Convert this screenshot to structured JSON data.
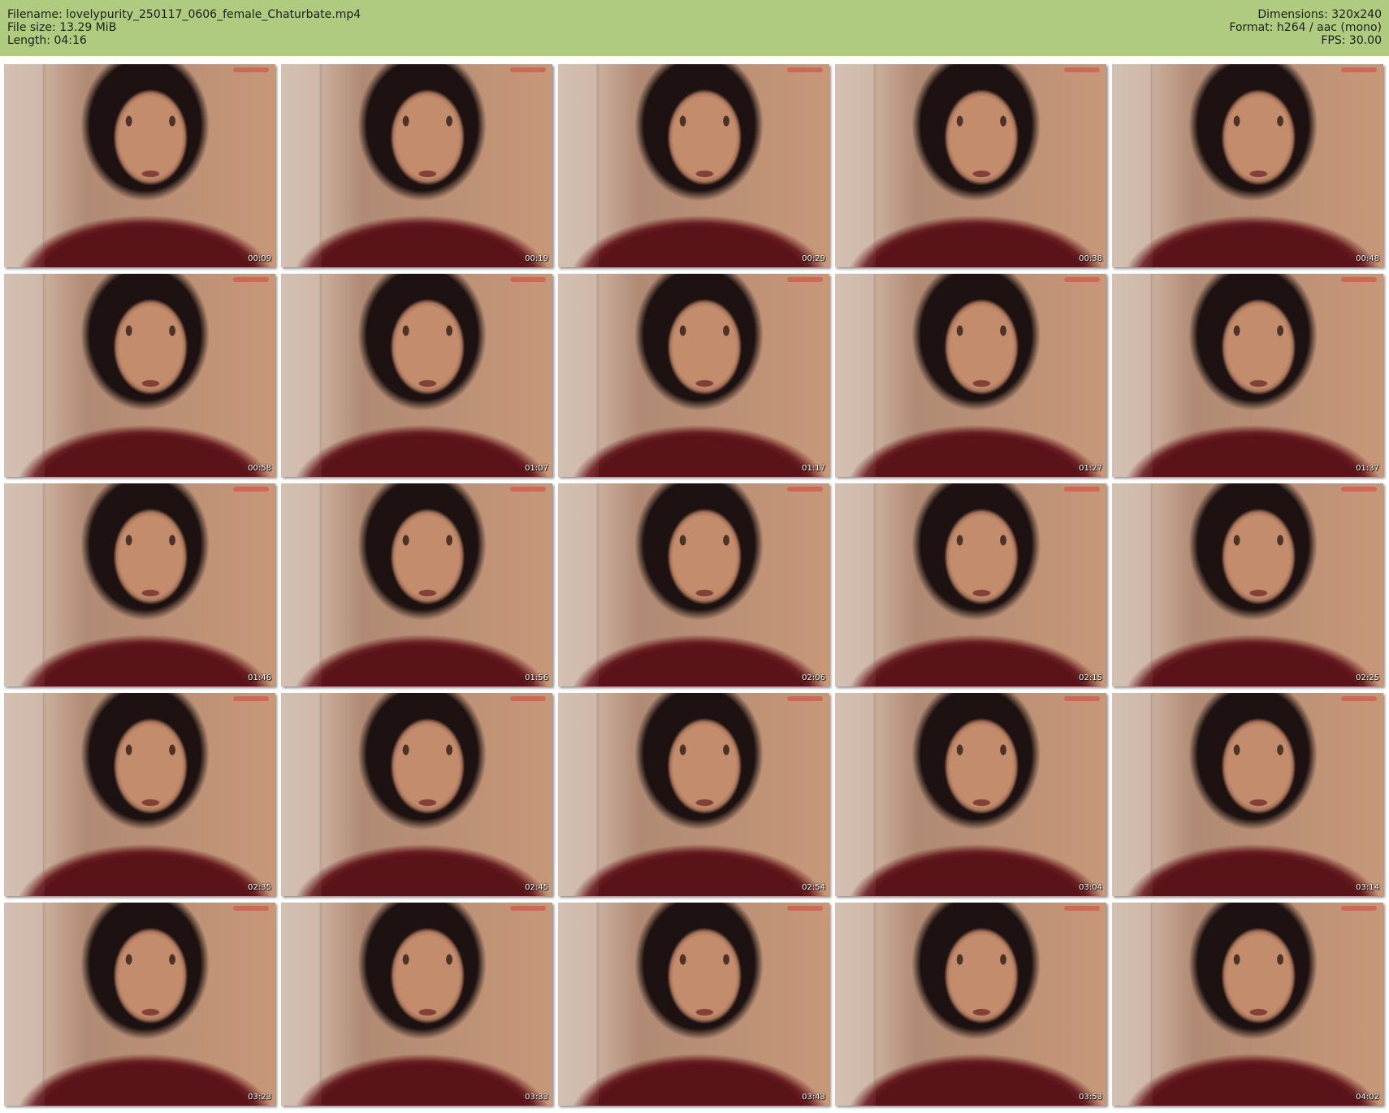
{
  "header": {
    "filename_label": "Filename: lovelypurity_250117_0606_female_Chaturbate.mp4",
    "filesize_label": "File size: 13.29 MiB",
    "length_label": "Length: 04:16",
    "dimensions_label": "Dimensions: 320x240",
    "format_label": "Format: h264 / aac (mono)",
    "fps_label": "FPS: 30.00",
    "background_color": "#afcb7f"
  },
  "thumbnails": [
    {
      "timestamp": "00:09"
    },
    {
      "timestamp": "00:19"
    },
    {
      "timestamp": "00:29"
    },
    {
      "timestamp": "00:38"
    },
    {
      "timestamp": "00:48"
    },
    {
      "timestamp": "00:58"
    },
    {
      "timestamp": "01:07"
    },
    {
      "timestamp": "01:17"
    },
    {
      "timestamp": "01:27"
    },
    {
      "timestamp": "01:37"
    },
    {
      "timestamp": "01:46"
    },
    {
      "timestamp": "01:56"
    },
    {
      "timestamp": "02:06"
    },
    {
      "timestamp": "02:15"
    },
    {
      "timestamp": "02:25"
    },
    {
      "timestamp": "02:35"
    },
    {
      "timestamp": "02:45"
    },
    {
      "timestamp": "02:54"
    },
    {
      "timestamp": "03:04"
    },
    {
      "timestamp": "03:14"
    },
    {
      "timestamp": "03:23"
    },
    {
      "timestamp": "03:33"
    },
    {
      "timestamp": "03:43"
    },
    {
      "timestamp": "03:53"
    },
    {
      "timestamp": "04:02"
    }
  ]
}
